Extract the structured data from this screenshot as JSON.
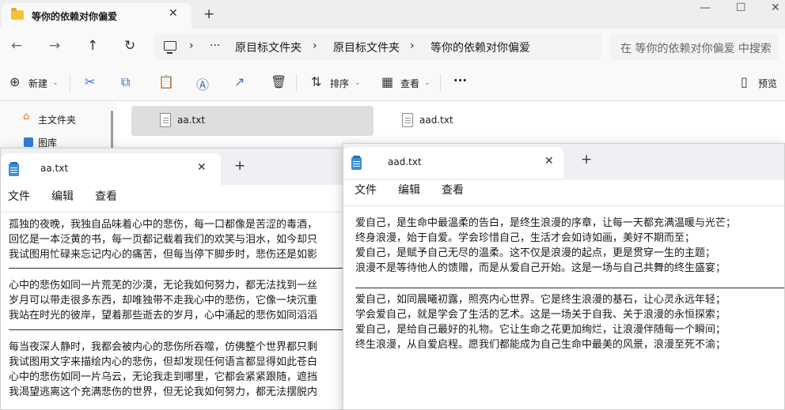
{
  "explorer": {
    "tab_title": "等你的依赖对你偏爱",
    "tab_close": "✕",
    "tab_add": "+",
    "window_controls": {
      "minimize": "—",
      "maximize": "☐",
      "close": "✕"
    },
    "nav": {
      "back": "←",
      "forward": "→",
      "up": "↑",
      "refresh": "↻",
      "more": "···"
    },
    "breadcrumbs": [
      "原目标文件夹",
      "原目标文件夹",
      "等你的依赖对你偏爱"
    ],
    "breadcrumb_sep": "›",
    "search_placeholder": "在 等你的依赖对你偏爱 中搜索",
    "commands": {
      "new_icon": "⊕",
      "new_label": "新建",
      "cut_icon": "✂",
      "copy_icon": "⧉",
      "paste_icon": "📋",
      "rename_icon": "Ⓐ",
      "share_icon": "↗",
      "delete_icon": "🗑",
      "sort_icon": "⇅",
      "sort_label": "排序",
      "view_icon": "▦",
      "view_label": "查看",
      "more": "···",
      "preview_icon": "▯",
      "preview_label": "预览"
    },
    "nav_pane": {
      "home_label": "主文件夹",
      "gallery_label": "图库"
    },
    "files": [
      "aa.txt",
      "aad.txt"
    ]
  },
  "notepad_left": {
    "title": "aa.txt",
    "close": "✕",
    "add": "+",
    "menu": [
      "文件",
      "编辑",
      "查看"
    ],
    "lines": [
      "孤独的夜晚，我独自品味着心中的悲伤，每一口都像是苦涩的毒酒，",
      "回忆是一本泛黄的书，每一页都记载着我们的欢笑与泪水，如今却只",
      "我试图用忙碌来忘记内心的痛苦，但每当停下脚步时，悲伤还是如影",
      "心中的悲伤如同一片荒芜的沙漠，无论我如何努力，都无法找到一丝",
      "岁月可以带走很多东西，却唯独带不走我心中的悲伤，它像一块沉重",
      "我站在时光的彼岸，望着那些逝去的岁月，心中涌起的悲伤如同滔滔",
      "每当夜深人静时，我都会被内心的悲伤所吞噬，仿佛整个世界都只剩",
      "我试图用文字来描绘内心的悲伤，但却发现任何语言都显得如此苍白",
      "心中的悲伤如同一片乌云，无论我走到哪里，它都会紧紧跟随，遮挡",
      "我渴望逃离这个充满悲伤的世界，但无论我如何努力，都无法摆脱内"
    ]
  },
  "notepad_right": {
    "title": "aad.txt",
    "close": "✕",
    "add": "+",
    "menu": [
      "文件",
      "编辑",
      "查看"
    ],
    "lines": [
      "爱自己，是生命中最温柔的告白，是终生浪漫的序章，让每一天都充满温暖与光芒；",
      "终身浪漫，始于自爱。学会珍惜自己，生活才会如诗如画，美好不期而至；",
      "爱自己，是赋予自己无尽的温柔。这不仅是浪漫的起点，更是贯穿一生的主题；",
      "浪漫不是等待他人的馈赠，而是从爱自己开始。这是一场与自己共舞的终生盛宴；",
      "爱自己，如同晨曦初露，照亮内心世界。它是终生浪漫的基石，让心灵永远年轻；",
      "学会爱自己，就是学会了生活的艺术。这是一场关于自我、关于浪漫的永恒探索；",
      "爱自己，是给自己最好的礼物。它让生命之花更加绚烂，让浪漫伴随每一个瞬间；",
      "终生浪漫，从自爱启程。愿我们都能成为自己生命中最美的风景，浪漫至死不渝；"
    ]
  }
}
